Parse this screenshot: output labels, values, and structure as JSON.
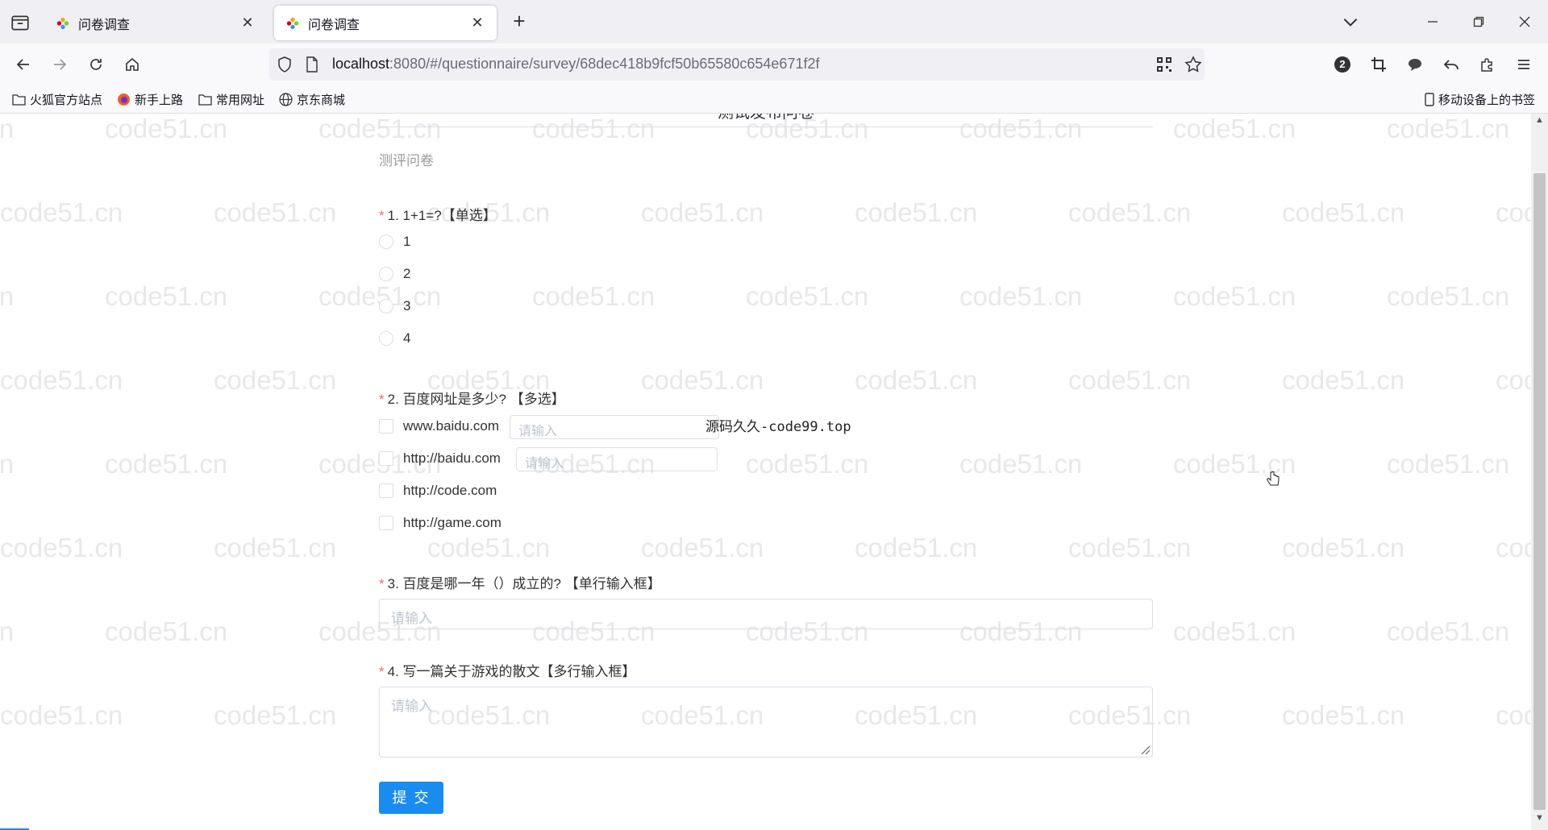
{
  "browser": {
    "tabs": [
      {
        "title": "问卷调查",
        "active": false
      },
      {
        "title": "问卷调查",
        "active": true
      }
    ],
    "url_host": "localhost",
    "url_rest": ":8080/#/questionnaire/survey/68dec418b9fcf50b65580c654e671f2f",
    "badge_count": "2",
    "bookmarks": [
      {
        "label": "火狐官方站点",
        "icon": "folder-icon"
      },
      {
        "label": "新手上路",
        "icon": "firefox-icon"
      },
      {
        "label": "常用网址",
        "icon": "folder-icon"
      },
      {
        "label": "京东商城",
        "icon": "globe-icon"
      }
    ],
    "mobile_bookmarks": "移动设备上的书签"
  },
  "watermark_text": "code51.cn",
  "survey": {
    "title": "测试发布问卷",
    "description": "测评问卷",
    "questions": [
      {
        "number": "1.",
        "text": "1+1=?【单选】",
        "type": "radio",
        "options": [
          "1",
          "2",
          "3",
          "4"
        ]
      },
      {
        "number": "2.",
        "text": "百度网址是多少? 【多选】",
        "type": "checkbox",
        "options": [
          "www.baidu.com",
          "http://baidu.com",
          "http://code.com",
          "http://game.com"
        ],
        "option_input_placeholder": "请输入"
      },
      {
        "number": "3.",
        "text": "百度是哪一年（）成立的? 【单行输入框】",
        "type": "input",
        "placeholder": "请输入"
      },
      {
        "number": "4.",
        "text": "写一篇关于游戏的散文【多行输入框】",
        "type": "textarea",
        "placeholder": "请输入"
      }
    ],
    "submit_label": "提 交"
  },
  "overlay_text": "源码久久-code99.top",
  "colors": {
    "primary": "#1a8cf0",
    "required": "#f56c6c",
    "border": "#dcdfe6",
    "placeholder": "#c0c4cc"
  }
}
